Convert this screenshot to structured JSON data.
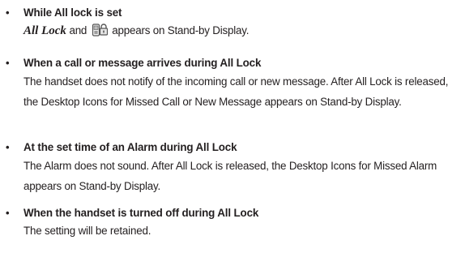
{
  "items": [
    {
      "heading": "While All lock is set",
      "text_label": "All Lock",
      "text_and": " and ",
      "icon": "phone-lock-icon",
      "text_rest": " appears on Stand-by Display."
    },
    {
      "heading": "When a call or message arrives during All Lock",
      "text": "The handset does not notify of the incoming call or new message. After All Lock is released, the Desktop Icons for Missed Call or New Message appears on Stand-by Display."
    },
    {
      "heading": "At the set time of an Alarm during All Lock",
      "text": "The Alarm does not sound. After All Lock is released, the Desktop Icons for Missed Alarm appears on Stand-by Display."
    },
    {
      "heading": "When the handset is turned off during All Lock",
      "text": "The setting will be retained."
    }
  ],
  "bullet_char": "•"
}
